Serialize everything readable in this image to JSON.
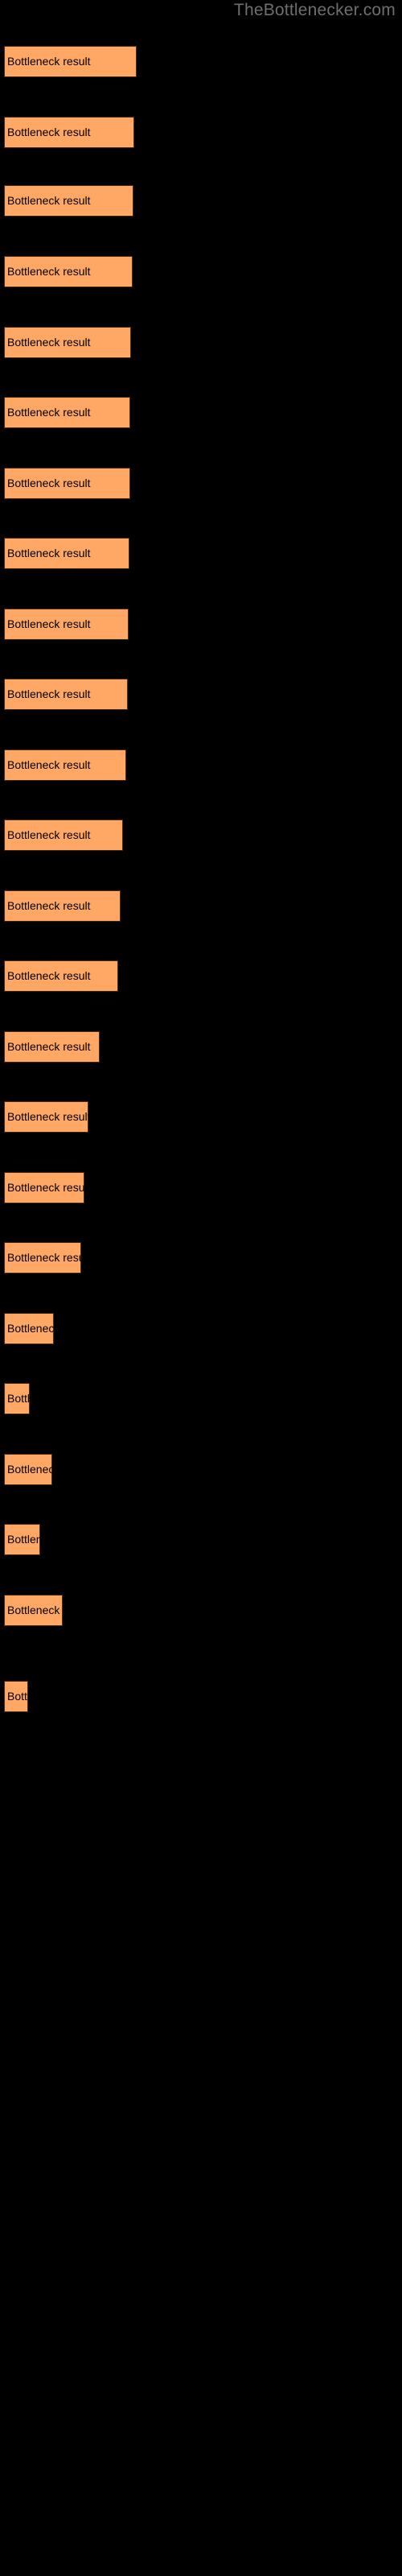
{
  "watermark": "TheBottlenecker.com",
  "colors": {
    "background": "#000000",
    "bar_fill": "#FFA765",
    "bar_border": "#4a2a12",
    "label_text": "#000000",
    "watermark_text": "#6e6e6e"
  },
  "chart_data": {
    "type": "bar",
    "orientation": "horizontal",
    "title": "",
    "subtitle": "",
    "xlabel": "",
    "ylabel": "",
    "grid": false,
    "legend": "none",
    "axis_visible": false,
    "tick_labels": [],
    "bar_label_text": "Bottleneck result",
    "categories": [
      "Bottleneck result",
      "Bottleneck result",
      "Bottleneck result",
      "Bottleneck result",
      "Bottleneck result",
      "Bottleneck result",
      "Bottleneck result",
      "Bottleneck result",
      "Bottleneck result",
      "Bottleneck result",
      "Bottleneck result",
      "Bottleneck result",
      "Bottleneck result",
      "Bottleneck result",
      "Bottleneck result",
      "Bottleneck result",
      "Bottleneck result",
      "Bottleneck result",
      "Bottleneck result",
      "Bottleneck result",
      "Bottleneck result",
      "Bottleneck result",
      "Bottleneck result",
      "Bottleneck result"
    ],
    "values": [
      165,
      162,
      161,
      160,
      158,
      157,
      157,
      156,
      155,
      154,
      152,
      148,
      145,
      142,
      119,
      105,
      100,
      96,
      62,
      32,
      60,
      45,
      73,
      30
    ],
    "xlim": [
      0,
      495
    ],
    "bars": [
      {
        "index": 1,
        "y": 57,
        "width": 165,
        "label": "Bottleneck result"
      },
      {
        "index": 2,
        "y": 145,
        "width": 162,
        "label": "Bottleneck result"
      },
      {
        "index": 3,
        "y": 230,
        "width": 161,
        "label": "Bottleneck result"
      },
      {
        "index": 4,
        "y": 318,
        "width": 160,
        "label": "Bottleneck result"
      },
      {
        "index": 5,
        "y": 406,
        "width": 158,
        "label": "Bottleneck result"
      },
      {
        "index": 6,
        "y": 493,
        "width": 157,
        "label": "Bottleneck result"
      },
      {
        "index": 7,
        "y": 581,
        "width": 157,
        "label": "Bottleneck result"
      },
      {
        "index": 8,
        "y": 668,
        "width": 156,
        "label": "Bottleneck result"
      },
      {
        "index": 9,
        "y": 756,
        "width": 155,
        "label": "Bottleneck result"
      },
      {
        "index": 10,
        "y": 843,
        "width": 154,
        "label": "Bottleneck result"
      },
      {
        "index": 11,
        "y": 931,
        "width": 152,
        "label": "Bottleneck result"
      },
      {
        "index": 12,
        "y": 1018,
        "width": 148,
        "label": "Bottleneck result"
      },
      {
        "index": 13,
        "y": 1106,
        "width": 145,
        "label": "Bottleneck result"
      },
      {
        "index": 14,
        "y": 1193,
        "width": 142,
        "label": "Bottleneck result"
      },
      {
        "index": 15,
        "y": 1281,
        "width": 119,
        "label": "Bottleneck result"
      },
      {
        "index": 16,
        "y": 1368,
        "width": 105,
        "label": "Bottleneck result"
      },
      {
        "index": 17,
        "y": 1456,
        "width": 100,
        "label": "Bottleneck result"
      },
      {
        "index": 18,
        "y": 1543,
        "width": 96,
        "label": "Bottleneck result"
      },
      {
        "index": 19,
        "y": 1631,
        "width": 62,
        "label": "Bottleneck result"
      },
      {
        "index": 20,
        "y": 1718,
        "width": 32,
        "label": "Bottleneck result"
      },
      {
        "index": 21,
        "y": 1806,
        "width": 60,
        "label": "Bottleneck result"
      },
      {
        "index": 22,
        "y": 1893,
        "width": 45,
        "label": "Bottleneck result"
      },
      {
        "index": 23,
        "y": 1981,
        "width": 73,
        "label": "Bottleneck result"
      },
      {
        "index": 24,
        "y": 2088,
        "width": 30,
        "label": "Bottleneck result"
      }
    ]
  }
}
